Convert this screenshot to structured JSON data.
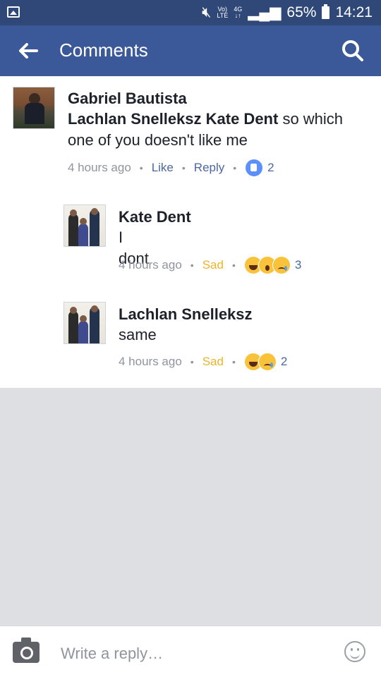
{
  "status_bar": {
    "battery": "65%",
    "time": "14:21",
    "network_top": "Vo)",
    "network_bottom": "LTE",
    "signal_type_top": "4G",
    "signal_type_bottom": "↓↑"
  },
  "header": {
    "title": "Comments",
    "back_icon": "arrow-left-icon",
    "search_icon": "search-icon"
  },
  "comments": [
    {
      "author": "Gabriel Bautista",
      "mentions": "Lachlan Snelleksz Kate Dent",
      "text": " so which one of you doesn't like me",
      "time": "4 hours ago",
      "action1": "Like",
      "action2": "Reply",
      "reactions": [
        "like"
      ],
      "reaction_count": "2"
    },
    {
      "author": "Kate Dent",
      "text": "I dont",
      "time": "4 hours ago",
      "action1": "Sad",
      "reactions": [
        "haha",
        "wow",
        "sad"
      ],
      "reaction_count": "3"
    },
    {
      "author": "Lachlan Snelleksz",
      "text": "same",
      "time": "4 hours ago",
      "action1": "Sad",
      "reactions": [
        "haha",
        "sad"
      ],
      "reaction_count": "2"
    }
  ],
  "reply_bar": {
    "placeholder": "Write a reply…",
    "camera_icon": "camera-icon",
    "emoji_icon": "smiley-icon"
  },
  "colors": {
    "header": "#3b5998",
    "status_bar": "#2f4877",
    "link": "#4b67a1",
    "sad": "#e9b52b"
  }
}
